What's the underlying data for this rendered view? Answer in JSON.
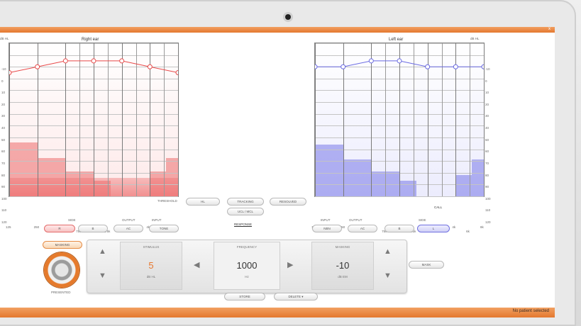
{
  "window": {
    "close_label": "x"
  },
  "right_ear": {
    "title": "Right ear",
    "y_labels": [
      "-10",
      "0",
      "10",
      "20",
      "30",
      "40",
      "50",
      "60",
      "70",
      "80",
      "90",
      "100",
      "110",
      "120"
    ],
    "x_labels": [
      "125",
      "250",
      "500",
      "1k",
      "2k",
      "4k",
      "8k"
    ],
    "x_sub_labels": [
      "750",
      "1.5k",
      "3k",
      "6k"
    ],
    "corner_label": "dB HL",
    "color": "#e84a4a",
    "thresholds_db": [
      15,
      10,
      5,
      5,
      5,
      10,
      15
    ]
  },
  "left_ear": {
    "title": "Left ear",
    "y_labels": [
      "-10",
      "0",
      "10",
      "20",
      "30",
      "40",
      "50",
      "60",
      "70",
      "80",
      "90",
      "100",
      "110",
      "120"
    ],
    "x_labels": [
      "125",
      "250",
      "500",
      "1k",
      "2k",
      "4k",
      "8k"
    ],
    "x_sub_labels": [
      "750",
      "1.5k",
      "3k",
      "6k"
    ],
    "corner_label": "dB HL",
    "color": "#6a6ae2",
    "thresholds_db": [
      10,
      10,
      5,
      5,
      10,
      10,
      10
    ]
  },
  "toolbar": {
    "threshold_label": "THRESHOLD",
    "hl_label": "HL",
    "tracking_label": "TRACKING",
    "resolved_label": "RESOLVED",
    "ucl_label": "UCL / MCL",
    "level_indicator": "CALL"
  },
  "left_controls": {
    "side_label": "SIDE",
    "output_label": "OUTPUT",
    "input_label": "INPUT",
    "side_active": "R",
    "side_other": "B",
    "output": "AC",
    "input": "TONE",
    "masking_label": "MASKING",
    "dial_label": "PRESENTED"
  },
  "right_controls": {
    "input_label": "INPUT",
    "output_label": "OUTPUT",
    "side_label": "SIDE",
    "input": "NBN",
    "output": "AC",
    "side_other": "B",
    "side_active": "L",
    "extra_button": "MASK"
  },
  "response_label": "RESPONSE",
  "stimulus": {
    "header": "STIMULUS",
    "value": "5",
    "unit": "dB HL",
    "value_color": "#e8782f"
  },
  "frequency": {
    "header": "FREQUENCY",
    "value": "1000",
    "unit": "Hz"
  },
  "masking": {
    "header": "MASKING",
    "value": "-10",
    "unit": "dB EM"
  },
  "bottom_buttons": {
    "store": "STORE",
    "delete": "DELETE"
  },
  "status": {
    "text": "No patient selected"
  }
}
